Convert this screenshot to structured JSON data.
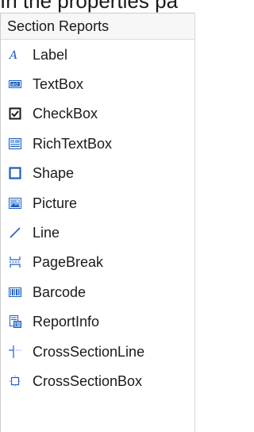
{
  "caption": "In the properties pa",
  "toolbox": {
    "header": "Section Reports",
    "items": [
      {
        "label": "Label",
        "icon": "label-icon"
      },
      {
        "label": "TextBox",
        "icon": "textbox-icon"
      },
      {
        "label": "CheckBox",
        "icon": "checkbox-icon"
      },
      {
        "label": "RichTextBox",
        "icon": "richtextbox-icon"
      },
      {
        "label": "Shape",
        "icon": "shape-icon"
      },
      {
        "label": "Picture",
        "icon": "picture-icon"
      },
      {
        "label": "Line",
        "icon": "line-icon"
      },
      {
        "label": "PageBreak",
        "icon": "pagebreak-icon"
      },
      {
        "label": "Barcode",
        "icon": "barcode-icon"
      },
      {
        "label": "ReportInfo",
        "icon": "reportinfo-icon"
      },
      {
        "label": "CrossSectionLine",
        "icon": "crosssectionline-icon"
      },
      {
        "label": "CrossSectionBox",
        "icon": "crosssectionbox-icon"
      }
    ],
    "colors": {
      "icon_blue": "#1f5fbf",
      "icon_dark": "#1a1a1a",
      "icon_light_blue": "#8db3e6"
    }
  }
}
